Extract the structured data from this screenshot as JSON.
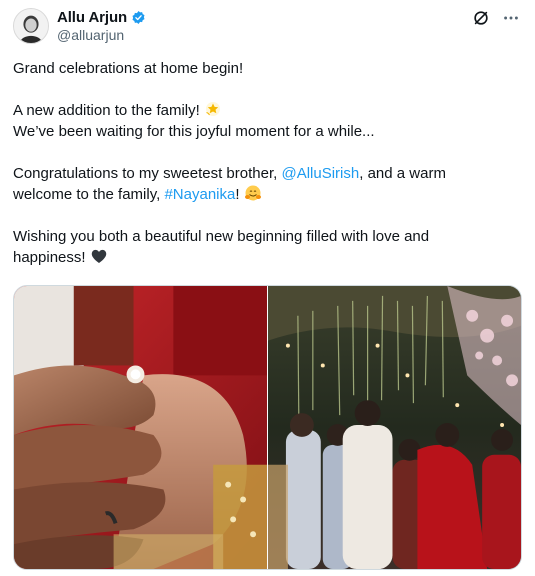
{
  "author": {
    "display_name": "Allu Arjun",
    "handle": "@alluarjun",
    "verified": true
  },
  "icons": {
    "avatar": "profile-photo",
    "verified": "verified-badge-icon",
    "grok": "grok-icon",
    "more": "more-icon"
  },
  "tweet": {
    "line1": "Grand celebrations at home begin!",
    "line2": "A new addition to the family!",
    "line3": "We’ve been waiting for this joyful moment for a while...",
    "line4_pre": "Congratulations to my sweetest brother, ",
    "mention": "@AlluSirish",
    "line4_post": ", and a warm",
    "line5_pre": "welcome to the family, ",
    "hashtag": "#Nayanika",
    "line5_post": "! ",
    "line6": "Wishing you both a beautiful new beginning filled with love and",
    "line7": "happiness! "
  },
  "colors": {
    "link": "#1d9bf0",
    "verified": "#1d9bf0",
    "text": "#0f1419",
    "secondary": "#536471"
  },
  "media": [
    {
      "description_icon": "ring-photo"
    },
    {
      "description_icon": "celebration-photo"
    }
  ]
}
